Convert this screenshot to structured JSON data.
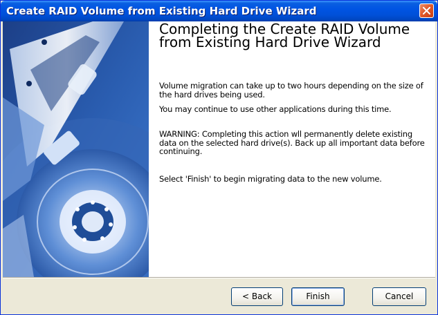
{
  "window": {
    "title": "Create RAID Volume from Existing Hard Drive Wizard"
  },
  "content": {
    "heading": "Completing the Create RAID Volume from Existing Hard Drive Wizard",
    "paragraphs": [
      "Volume migration can take up to two hours depending on the size of the hard drives being used.",
      "You may continue to use other applications during this time.",
      "WARNING: Completing this action wll permanently delete existing data on the selected hard drive(s). Back up all important data before continuing.",
      "Select 'Finish' to begin migrating data to the new volume."
    ]
  },
  "buttons": {
    "back": "< Back",
    "finish": "Finish",
    "cancel": "Cancel"
  },
  "icons": {
    "close": "close-icon",
    "side_image": "hard-drive-image"
  },
  "colors": {
    "titlebar": "#0054e3",
    "close_button": "#e25b2c",
    "dialog_background": "#ece9d8",
    "content_background": "#ffffff"
  }
}
